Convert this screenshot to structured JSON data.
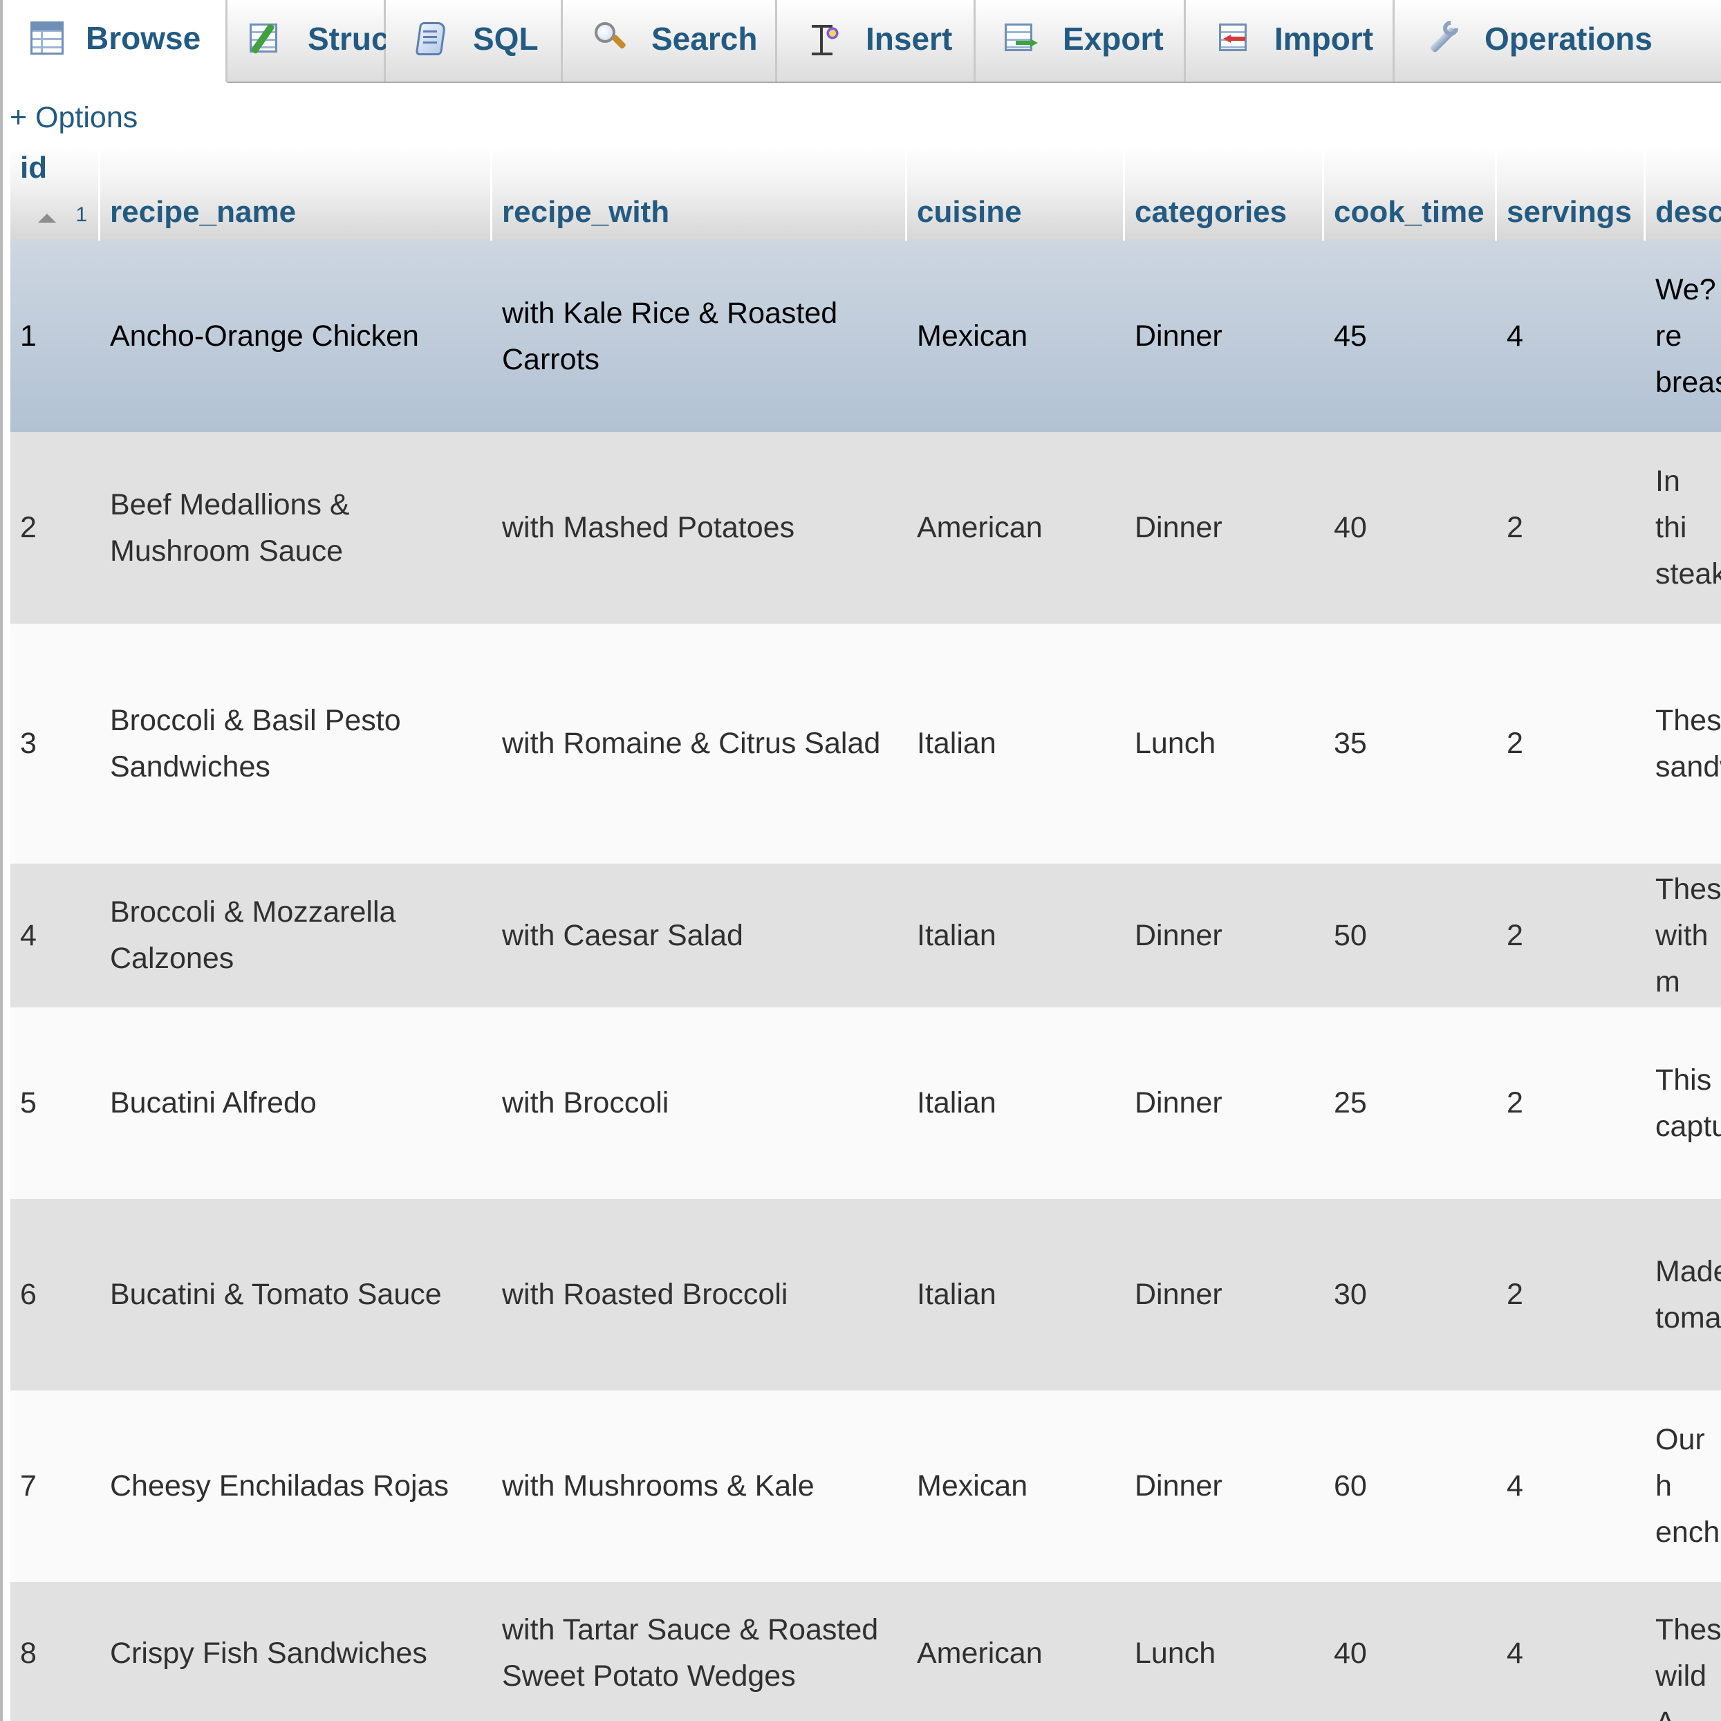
{
  "tabs": [
    {
      "label": "Browse",
      "icon": "browse-icon",
      "active": true
    },
    {
      "label": "Structure",
      "icon": "structure-icon"
    },
    {
      "label": "SQL",
      "icon": "sql-icon"
    },
    {
      "label": "Search",
      "icon": "search-icon"
    },
    {
      "label": "Insert",
      "icon": "insert-icon"
    },
    {
      "label": "Export",
      "icon": "export-icon"
    },
    {
      "label": "Import",
      "icon": "import-icon"
    },
    {
      "label": "Operations",
      "icon": "operations-icon"
    }
  ],
  "options_link": "+ Options",
  "table": {
    "sort": {
      "column": "id",
      "direction": "ascending",
      "order": "1"
    },
    "columns": [
      "id",
      "recipe_name",
      "recipe_with",
      "cuisine",
      "categories",
      "cook_time",
      "servings",
      "description"
    ],
    "rows": [
      {
        "id": "1",
        "recipe_name": "Ancho-Orange Chicken",
        "recipe_with": "with Kale Rice & Roasted Carrots",
        "cuisine": "Mexican",
        "categories": "Dinner",
        "cook_time": "45",
        "servings": "4",
        "description": "We?re breas",
        "selected": true
      },
      {
        "id": "2",
        "recipe_name": "Beef Medallions & Mushroom Sauce",
        "recipe_with": "with Mashed Potatoes",
        "cuisine": "American",
        "categories": "Dinner",
        "cook_time": "40",
        "servings": "2",
        "description": "In thi steak"
      },
      {
        "id": "3",
        "recipe_name": "Broccoli & Basil Pesto Sandwiches",
        "recipe_with": "with Romaine & Citrus Salad",
        "cuisine": "Italian",
        "categories": "Lunch",
        "cook_time": "35",
        "servings": "2",
        "description": "These sandw"
      },
      {
        "id": "4",
        "recipe_name": "Broccoli & Mozzarella Calzones",
        "recipe_with": "with Caesar Salad",
        "cuisine": "Italian",
        "categories": "Dinner",
        "cook_time": "50",
        "servings": "2",
        "description": "These with m"
      },
      {
        "id": "5",
        "recipe_name": "Bucatini Alfredo",
        "recipe_with": "with Broccoli",
        "cuisine": "Italian",
        "categories": "Dinner",
        "cook_time": "25",
        "servings": "2",
        "description": "This captu"
      },
      {
        "id": "6",
        "recipe_name": "Bucatini & Tomato Sauce",
        "recipe_with": "with Roasted Broccoli",
        "cuisine": "Italian",
        "categories": "Dinner",
        "cook_time": "30",
        "servings": "2",
        "description": "Made toma"
      },
      {
        "id": "7",
        "recipe_name": "Cheesy Enchiladas Rojas",
        "recipe_with": "with Mushrooms & Kale",
        "cuisine": "Mexican",
        "categories": "Dinner",
        "cook_time": "60",
        "servings": "4",
        "description": "Our h ench"
      },
      {
        "id": "8",
        "recipe_name": "Crispy Fish Sandwiches",
        "recipe_with": "with Tartar Sauce & Roasted Sweet Potato Wedges",
        "cuisine": "American",
        "categories": "Lunch",
        "cook_time": "40",
        "servings": "4",
        "description": "These wild A"
      }
    ]
  },
  "colors": {
    "link": "#235a81",
    "row_odd": "#fafafa",
    "row_even": "#e1e1e1",
    "row_selected": "#b2c2d3"
  }
}
